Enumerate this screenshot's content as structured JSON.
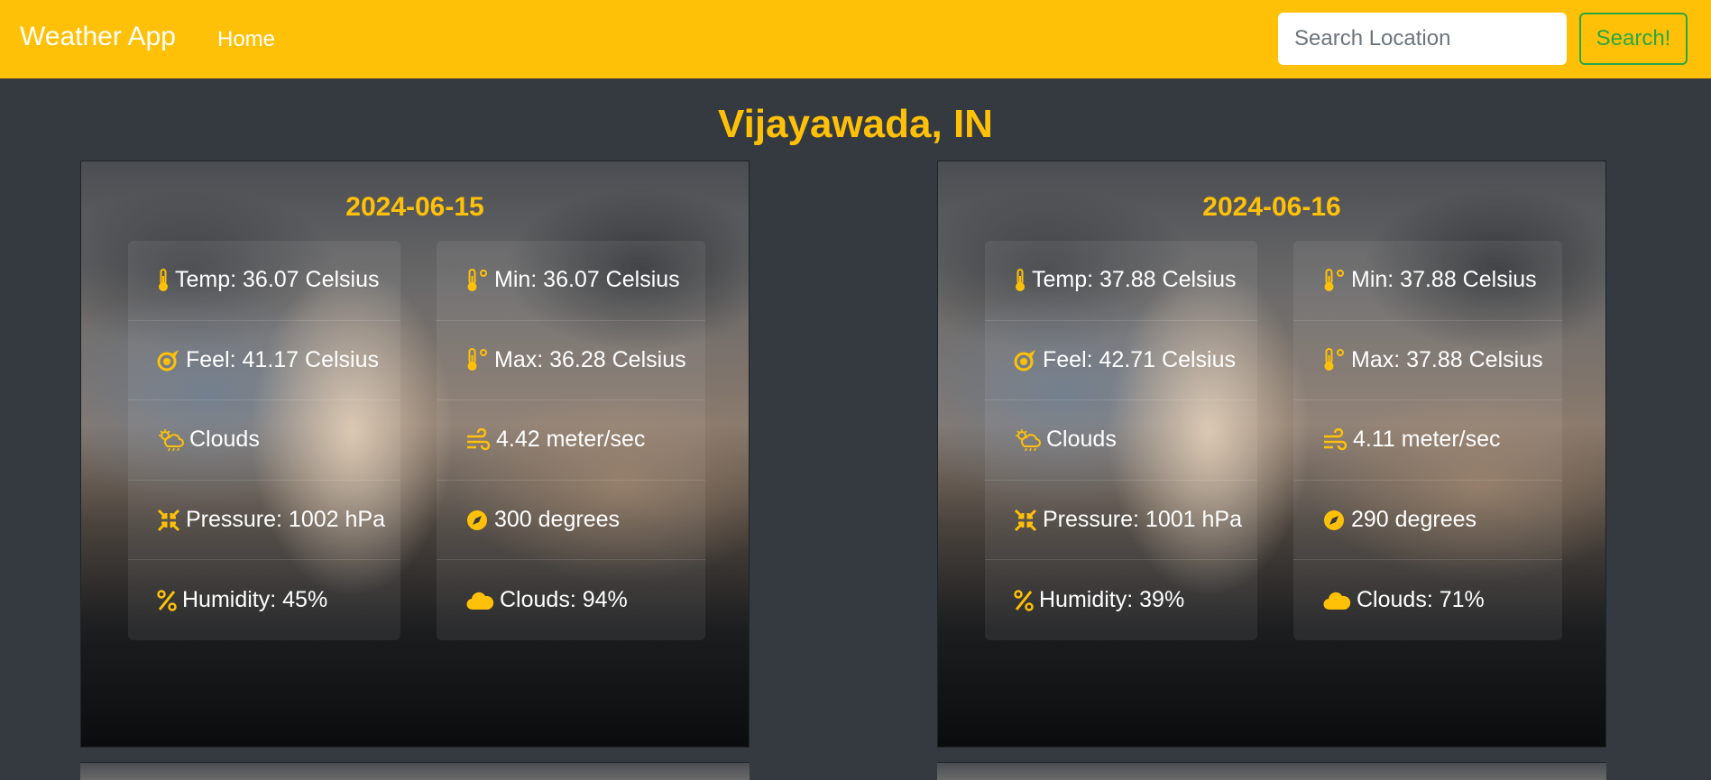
{
  "navbar": {
    "brand": "Weather App",
    "home_link": "Home",
    "search_placeholder": "Search Location",
    "search_button": "Search!"
  },
  "location": "Vijayawada, IN",
  "forecasts": [
    {
      "date": "2024-06-15",
      "temp": "Temp: 36.07 Celsius",
      "feel": "Feel: 41.17 Celsius",
      "condition": "Clouds",
      "pressure": "Pressure: 1002 hPa",
      "humidity": "Humidity: 45%",
      "min": "Min: 36.07 Celsius",
      "max": "Max: 36.28 Celsius",
      "wind_speed": "4.42 meter/sec",
      "wind_direction": "300 degrees",
      "clouds": "Clouds: 94%"
    },
    {
      "date": "2024-06-16",
      "temp": "Temp: 37.88 Celsius",
      "feel": "Feel: 42.71 Celsius",
      "condition": "Clouds",
      "pressure": "Pressure: 1001 hPa",
      "humidity": "Humidity: 39%",
      "min": "Min: 37.88 Celsius",
      "max": "Max: 37.88 Celsius",
      "wind_speed": "4.11 meter/sec",
      "wind_direction": "290 degrees",
      "clouds": "Clouds: 71%"
    }
  ],
  "colors": {
    "accent": "#ffc107",
    "background": "#343a40",
    "search_button": "#28a745"
  },
  "icons": [
    "thermometer-icon",
    "feels-like-icon",
    "cloud-sun-rain-icon",
    "pressure-icon",
    "percent-icon",
    "thermometer-degree-icon",
    "wind-icon",
    "compass-icon",
    "cloud-icon"
  ]
}
